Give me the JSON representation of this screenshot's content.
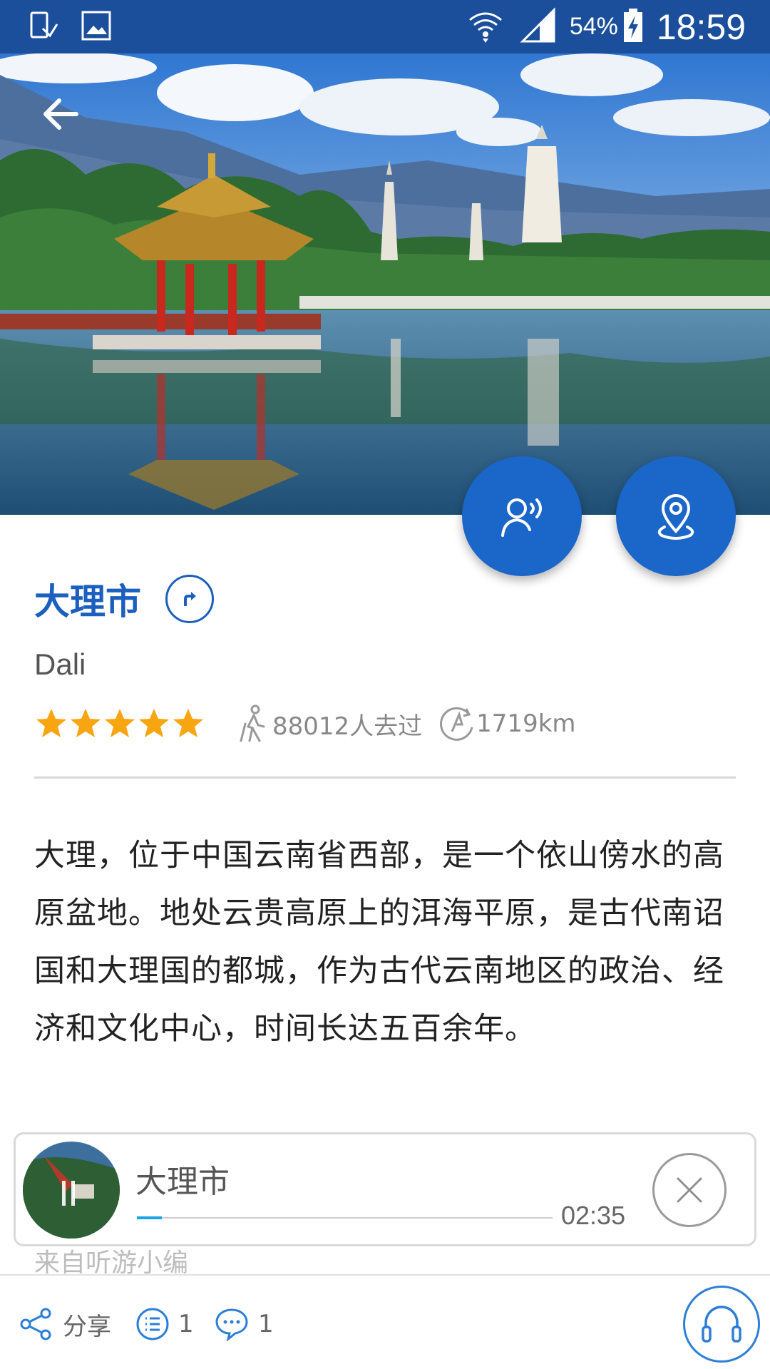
{
  "status_bar": {
    "battery_percent": "54%",
    "time": "18:59",
    "icons": [
      "device-sync-icon",
      "image-icon",
      "wifi-icon",
      "signal-icon",
      "battery-charging-icon"
    ]
  },
  "header": {
    "back_icon": "arrow-left-icon"
  },
  "fabs": {
    "audio_icon": "person-speaking-icon",
    "location_icon": "map-pin-icon",
    "color": "#1b66c9"
  },
  "place": {
    "title": "大理市",
    "subtitle": "Dali",
    "rating": 5,
    "visitors": "88012人去过",
    "distance": "1719km",
    "description": "大理，位于中国云南省西部，是一个依山傍水的高原盆地。地处云贵高原上的洱海平原，是古代南诏国和大理国的都城，作为古代云南地区的政治、经济和文化中心，时间长达五百余年。"
  },
  "player": {
    "title": "大理市",
    "time": "02:35",
    "progress": 0.06
  },
  "source_note": "来自听游小编",
  "bottom_bar": {
    "share_label": "分享",
    "list_count": "1",
    "comment_count": "1"
  },
  "colors": {
    "status_bar": "#1b4f9c",
    "accent": "#1b5fbf",
    "star": "#f7a612"
  }
}
